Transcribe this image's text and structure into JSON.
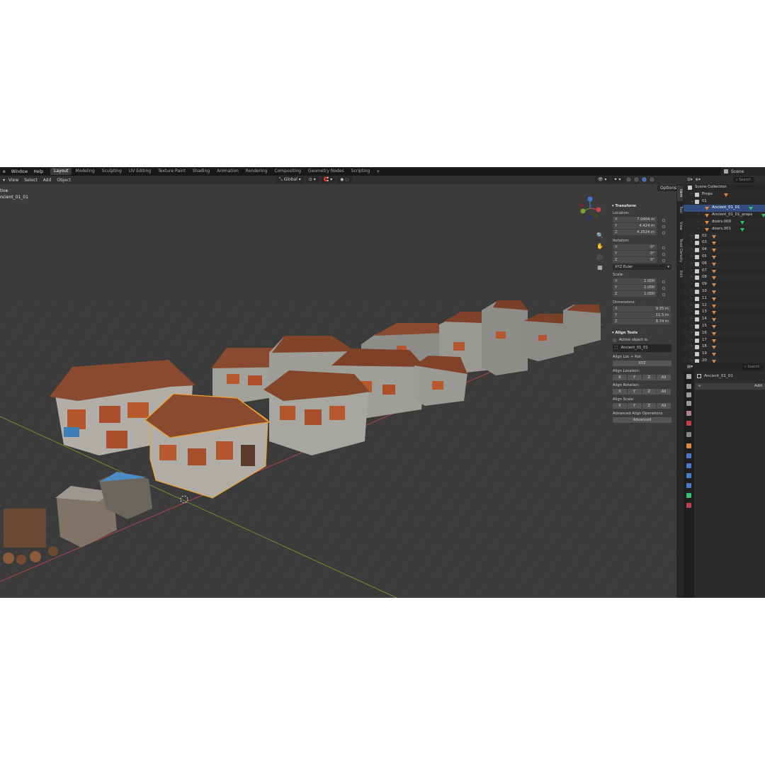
{
  "topbar": {
    "menus": [
      "e",
      "Window",
      "Help"
    ],
    "workspaces": [
      "Layout",
      "Modeling",
      "Sculpting",
      "UV Editing",
      "Texture Paint",
      "Shading",
      "Animation",
      "Rendering",
      "Compositing",
      "Geometry Nodes",
      "Scripting"
    ],
    "active_workspace": "Layout",
    "add_tab": "+",
    "scene": "Scene"
  },
  "viewport": {
    "header_menus": [
      "View",
      "Select",
      "Add",
      "Object"
    ],
    "orientation": "Global",
    "options": "Options",
    "info_line1": "tive",
    "info_line2": "ncient_01_01"
  },
  "npanel": {
    "transform_title": "Transform",
    "location_label": "Location:",
    "location": [
      "7.0404 m",
      "4.424 m",
      "4.2524 m"
    ],
    "rotation_label": "Rotation:",
    "rotation": [
      "0°",
      "0°",
      "0°"
    ],
    "rotation_mode": "XYZ Euler",
    "scale_label": "Scale:",
    "scale": [
      "1.000",
      "1.000",
      "1.000"
    ],
    "dimensions_label": "Dimensions:",
    "dimensions": [
      "9.35 m",
      "11.5 m",
      "8.74 m"
    ],
    "axis": [
      "X",
      "Y",
      "Z"
    ],
    "align_title": "Align Tools",
    "active_object_label": "Active object is:",
    "active_object": "Ancient_01_01",
    "align_loc_rot": "Align Loc + Rot:",
    "xyz": "XYZ",
    "align_location": "Align Location:",
    "align_rotation": "Align Rotation:",
    "align_scale": "Align Scale:",
    "all": "All",
    "advanced_ops": "Advanced Align Operations",
    "advanced": "Advanced"
  },
  "ntabs": [
    "Item",
    "Tool",
    "View",
    "Texel Density",
    "Edit"
  ],
  "outliner": {
    "search": "Search",
    "scene_collection": "Scene Collection",
    "props": "Props",
    "collection_01": "01",
    "selected": "Ancient_01_01",
    "children": [
      "Ancient_01_01_props",
      "doors.000",
      "doors.001"
    ],
    "collections": [
      "02",
      "03",
      "04",
      "05",
      "06",
      "07",
      "08",
      "09",
      "10",
      "11",
      "12",
      "13",
      "14",
      "15",
      "16",
      "17",
      "18",
      "19",
      "20"
    ]
  },
  "properties": {
    "search": "Search",
    "object": "Ancient_01_01",
    "add": "Add"
  },
  "colors": {
    "selection": "#334d80",
    "outline_selected": "#f0a030",
    "x_axis": "#c04050",
    "y_axis": "#7a9a30"
  }
}
